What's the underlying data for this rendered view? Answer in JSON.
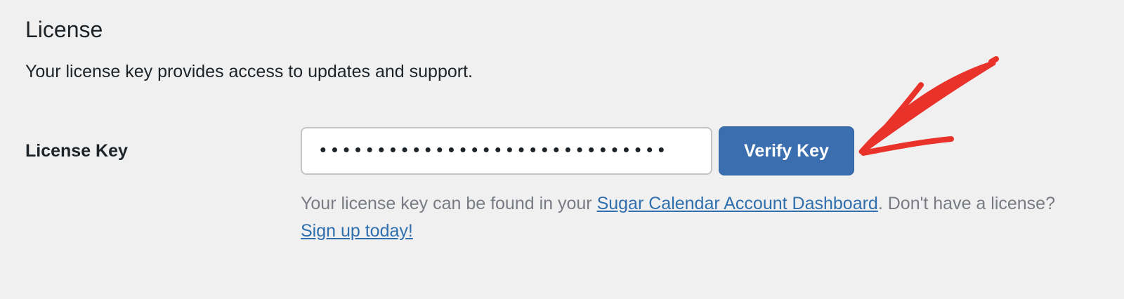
{
  "section": {
    "title": "License",
    "description": "Your license key provides access to updates and support."
  },
  "license_field": {
    "label": "License Key",
    "value": "••••••••••••••••••••••••••••••",
    "button_label": "Verify Key"
  },
  "help": {
    "text_before_link": "Your license key can be found in your ",
    "dashboard_link": "Sugar Calendar Account Dashboard",
    "text_between_links": ". Don't have a license? ",
    "signup_link": "Sign up today!"
  },
  "colors": {
    "background": "#f0f0f1",
    "button": "#3b6eaf",
    "link": "#2f6fae",
    "annotation": "#e8322a"
  }
}
